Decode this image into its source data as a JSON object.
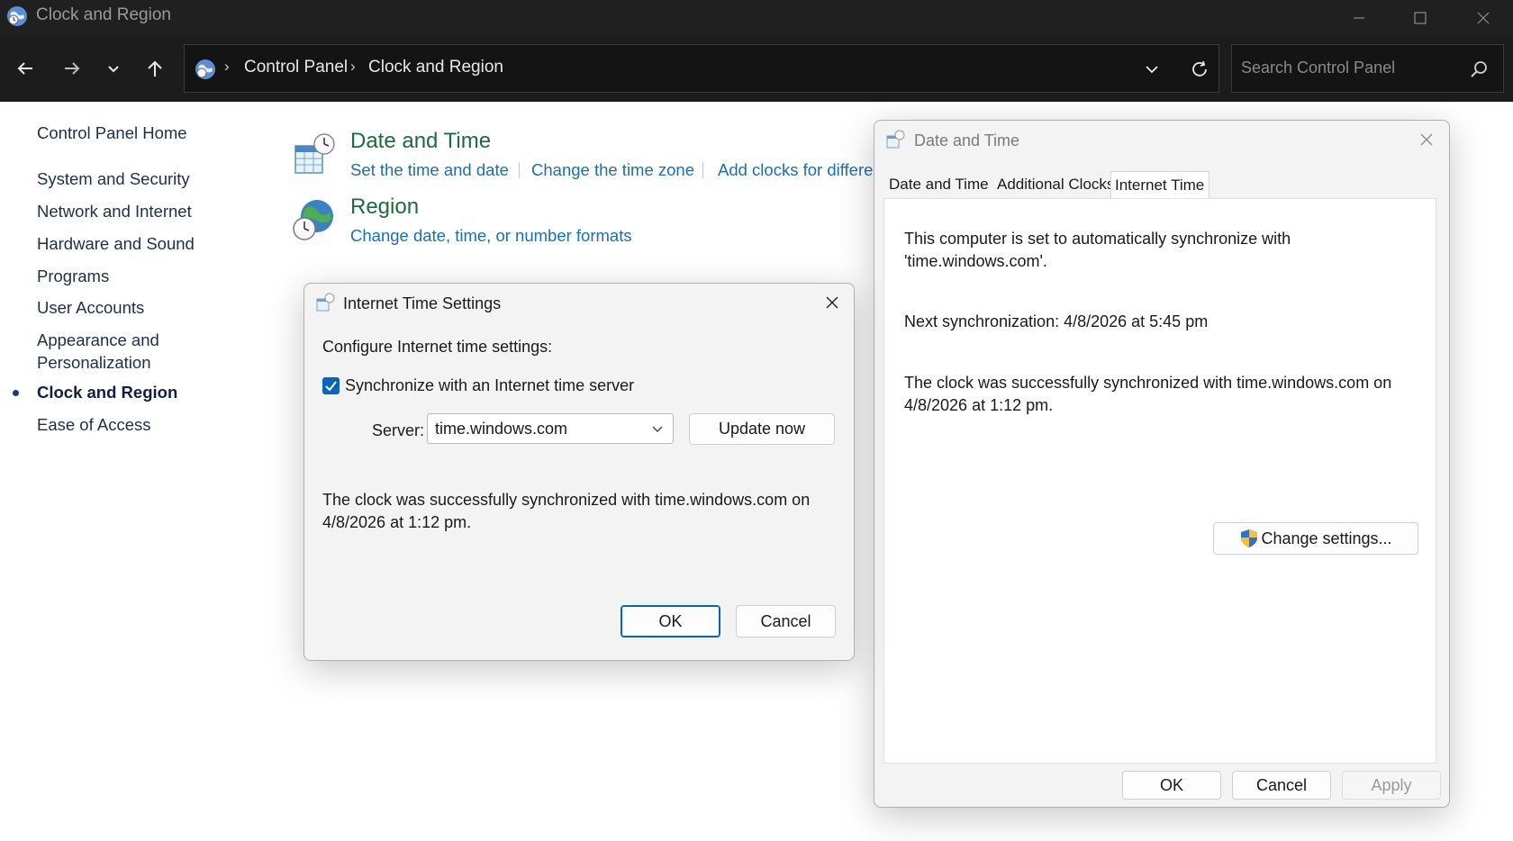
{
  "window": {
    "title": "Clock and Region"
  },
  "navbar": {
    "breadcrumb": [
      "Control Panel",
      "Clock and Region"
    ],
    "search_placeholder": "Search Control Panel"
  },
  "sidebar": {
    "home": "Control Panel Home",
    "items": [
      {
        "label": "System and Security"
      },
      {
        "label": "Network and Internet"
      },
      {
        "label": "Hardware and Sound"
      },
      {
        "label": "Programs"
      },
      {
        "label": "User Accounts"
      },
      {
        "label": "Appearance and"
      },
      {
        "label": "Personalization"
      },
      {
        "label": "Clock and Region",
        "active": true
      },
      {
        "label": "Ease of Access"
      }
    ]
  },
  "content": {
    "categories": [
      {
        "title": "Date and Time",
        "links": [
          "Set the time and date",
          "Change the time zone",
          "Add clocks for differe"
        ]
      },
      {
        "title": "Region",
        "links": [
          "Change date, time, or number formats"
        ]
      }
    ]
  },
  "internet_time_dialog": {
    "title": "Internet Time Settings",
    "configure_label": "Configure Internet time settings:",
    "sync_checkbox_label": "Synchronize with an Internet time server",
    "sync_checked": true,
    "server_label": "Server:",
    "server_value": "time.windows.com",
    "update_button": "Update now",
    "status_line1": "The clock was successfully synchronized with time.windows.com on",
    "status_line2": "4/8/2026 at 1:12 pm.",
    "ok_button": "OK",
    "cancel_button": "Cancel"
  },
  "date_time_dialog": {
    "title": "Date and Time",
    "tabs": [
      "Date and Time",
      "Additional Clocks",
      "Internet Time"
    ],
    "selected_tab": "Internet Time",
    "auto_sync_line1": "This computer is set to automatically synchronize with",
    "auto_sync_line2": "'time.windows.com'.",
    "next_sync": "Next synchronization: 4/8/2026 at 5:45 pm",
    "status_line1": "The clock was successfully synchronized with time.windows.com on",
    "status_line2": "4/8/2026 at 1:12 pm.",
    "change_settings_button": "Change settings...",
    "ok_button": "OK",
    "cancel_button": "Cancel",
    "apply_button": "Apply"
  },
  "colors": {
    "titlebar": "#202020",
    "navbar": "#1c1c1c",
    "link_blue": "#1a6fb8",
    "category_green": "#1e6b3c",
    "accent": "#0067c0"
  }
}
